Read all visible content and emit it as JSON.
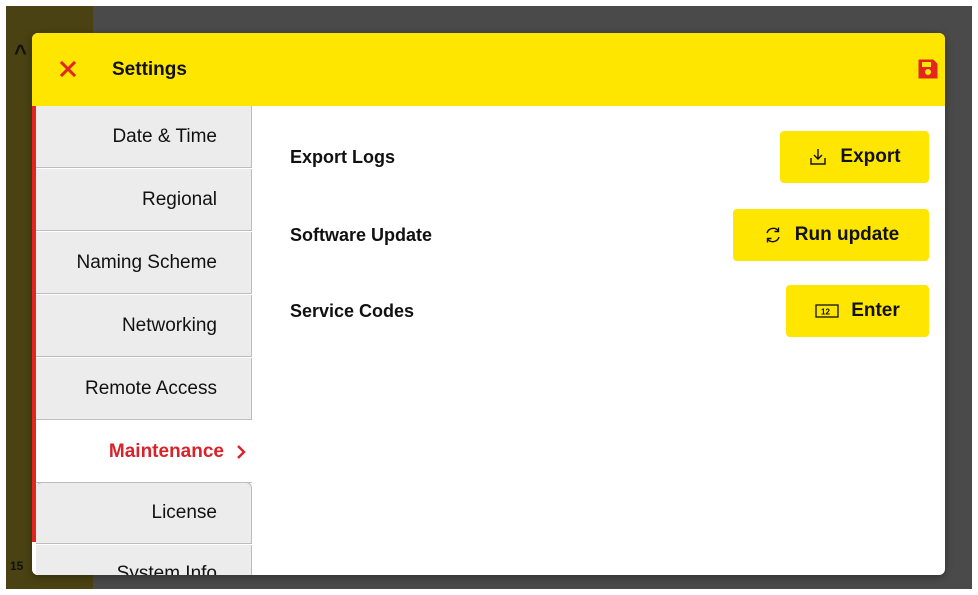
{
  "background": {
    "glyph": "^",
    "number": "15"
  },
  "dialog": {
    "title": "Settings",
    "close_icon": "close-icon",
    "save_icon": "save-icon",
    "accent_color": "#ffe600",
    "active_color": "#d8232a"
  },
  "sidebar": {
    "items": [
      {
        "label": "Date & Time"
      },
      {
        "label": "Regional"
      },
      {
        "label": "Naming Scheme"
      },
      {
        "label": "Networking"
      },
      {
        "label": "Remote Access"
      },
      {
        "label": "Maintenance",
        "active": true
      },
      {
        "label": "License"
      },
      {
        "label": "System Info"
      }
    ]
  },
  "content": {
    "rows": [
      {
        "label": "Export Logs",
        "button": "Export",
        "icon": "download-icon"
      },
      {
        "label": "Software Update",
        "button": "Run update",
        "icon": "refresh-icon"
      },
      {
        "label": "Service Codes",
        "button": "Enter",
        "icon": "keypad-icon"
      }
    ]
  }
}
